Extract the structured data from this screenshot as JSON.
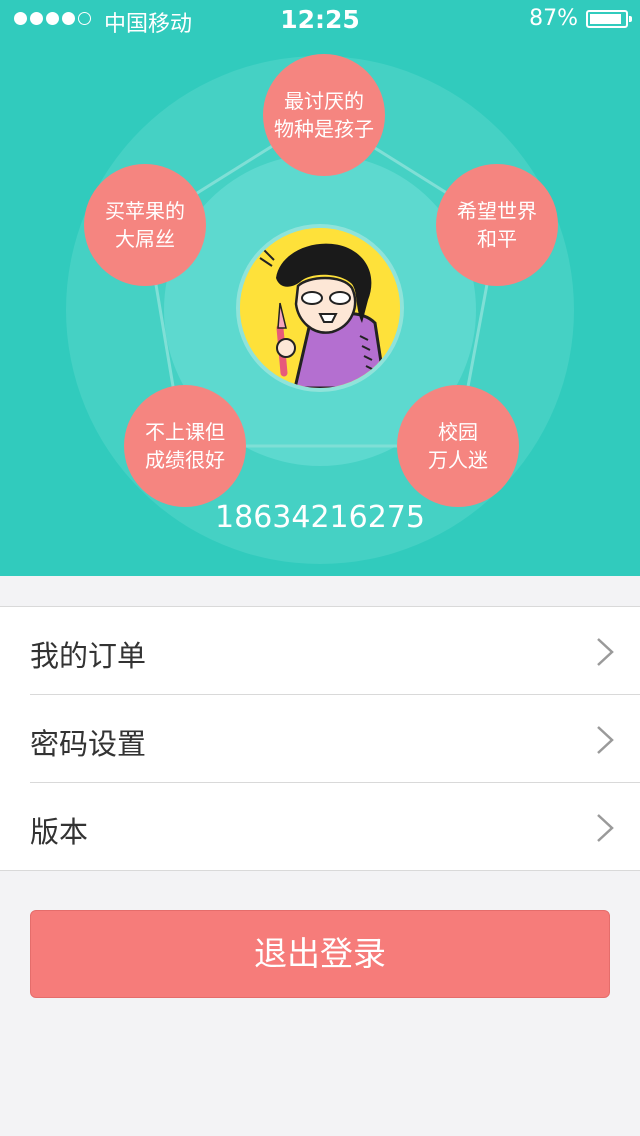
{
  "status_bar": {
    "carrier": "中国移动",
    "time": "12:25",
    "battery": "87%",
    "signal_bars": 4
  },
  "profile": {
    "tags": [
      {
        "lines": [
          "最讨厌的",
          "物种是孩子"
        ]
      },
      {
        "lines": [
          "买苹果的",
          "大屌丝"
        ]
      },
      {
        "lines": [
          "希望世界",
          "和平"
        ]
      },
      {
        "lines": [
          "不上课但",
          "成绩很好"
        ]
      },
      {
        "lines": [
          "校园",
          "万人迷"
        ]
      }
    ],
    "phone": "18634216275"
  },
  "menu": {
    "items": [
      {
        "label": "我的订单"
      },
      {
        "label": "密码设置"
      },
      {
        "label": "版本"
      }
    ]
  },
  "logout_label": "退出登录",
  "colors": {
    "header": "#31cbbd",
    "accent": "#f58580",
    "logout": "#f67c7a"
  }
}
